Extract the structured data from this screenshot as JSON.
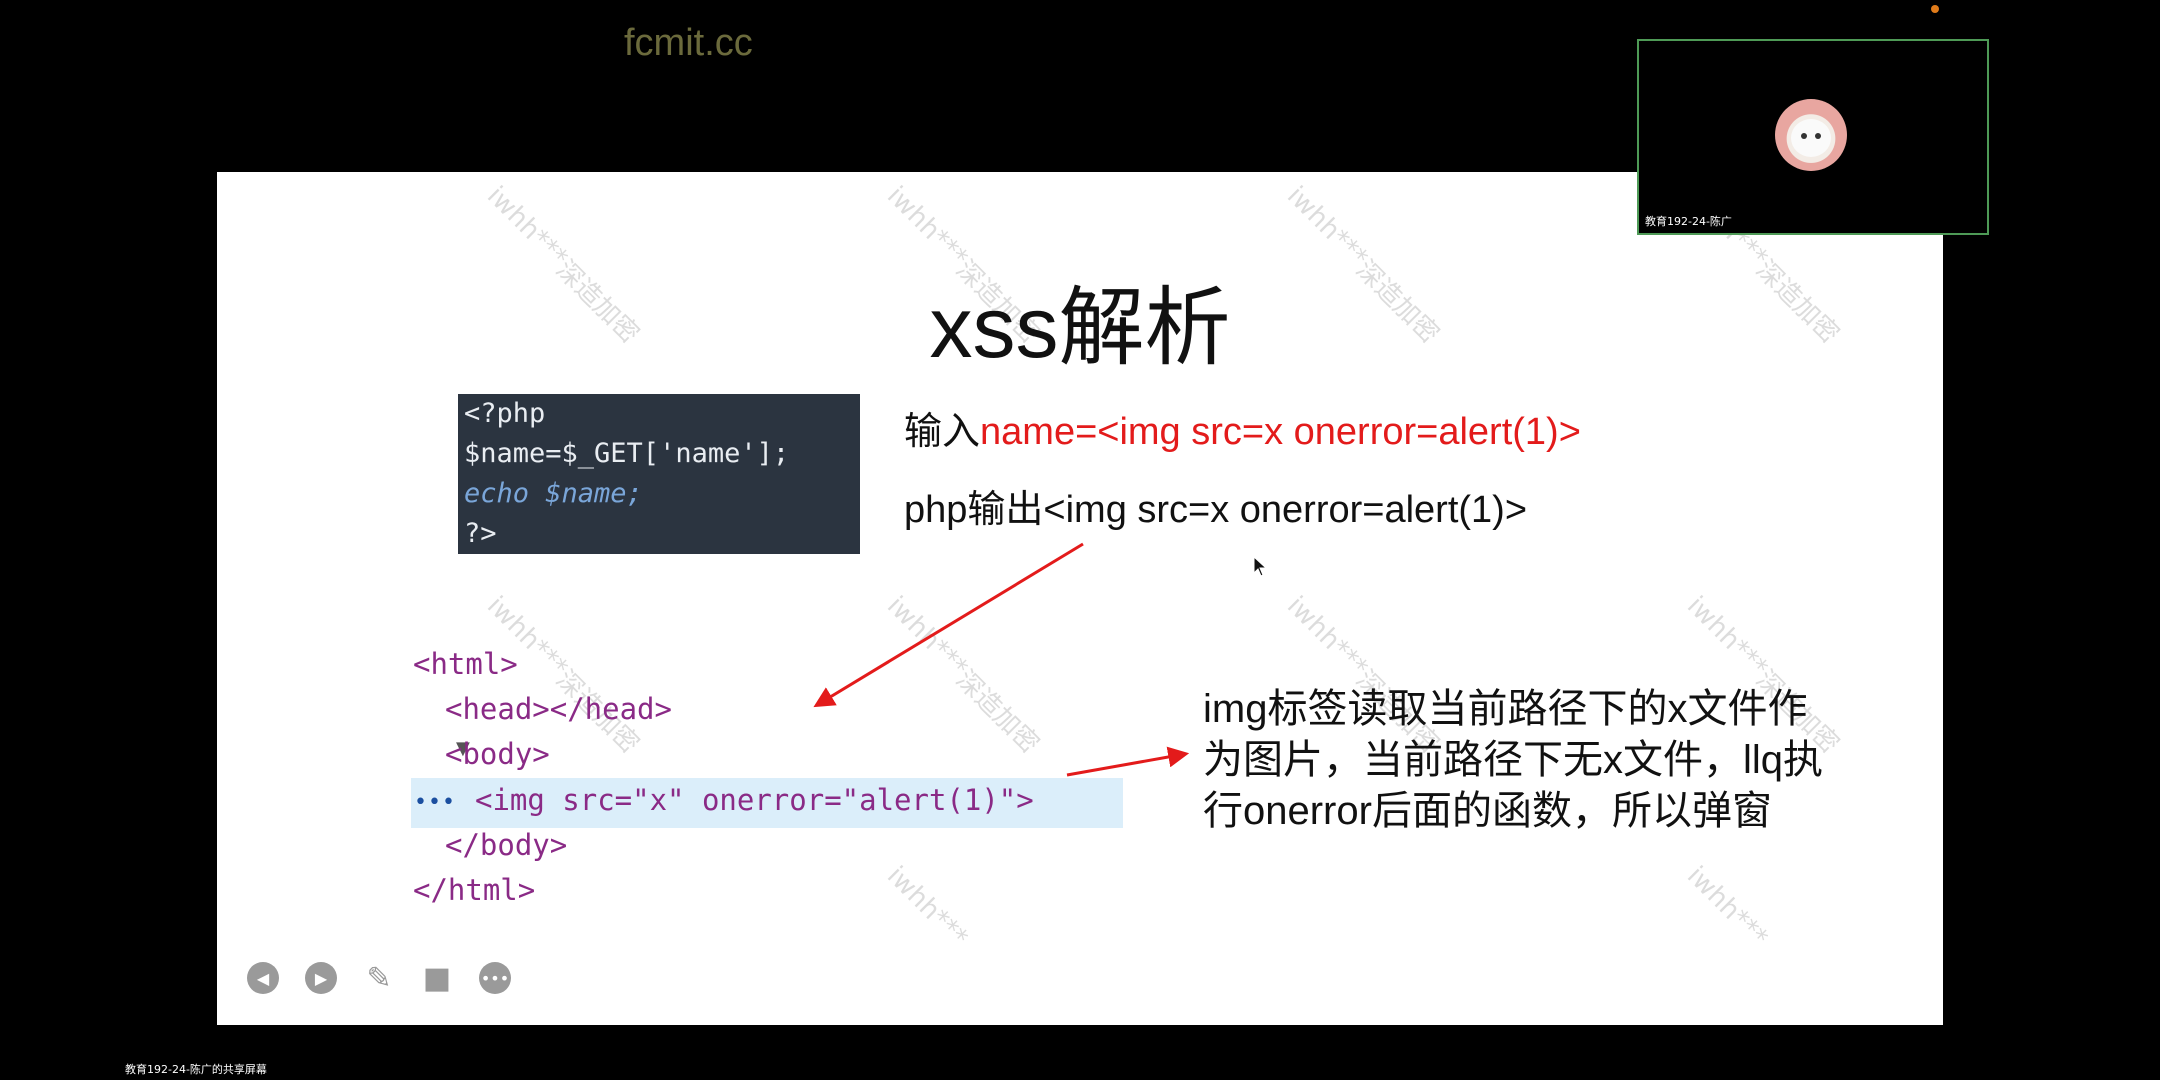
{
  "window": {
    "site_label": "fcmit.cc",
    "share_label": "教育192-24-陈广的共享屏幕"
  },
  "video_tile": {
    "participant_name": "教育192-24-陈广"
  },
  "slide": {
    "title": "xss解析",
    "php_code": [
      "<?php",
      "$name=$_GET['name'];",
      "echo $name;",
      "?>"
    ],
    "input_prefix": "输入",
    "input_payload": "name=<img src=x onerror=alert(1)>",
    "php_output": "php输出<img src=x onerror=alert(1)>",
    "dom_lines": [
      "<html>",
      "<head></head>",
      "<body>",
      "<img src=\"x\" onerror=\"alert(1)\">",
      "</body>",
      "</html>"
    ],
    "explanation": "img标签读取当前路径下的x文件作为图片，当前路径下无x文件，llq执行onerror后面的函数，所以弹窗",
    "watermark_user": "iwhh***",
    "watermark_org": "深造加密"
  },
  "toolbar": {
    "icons": [
      "prev-icon",
      "next-icon",
      "pen-icon",
      "camera-icon",
      "more-icon"
    ]
  },
  "colors": {
    "highlight_red": "#e31b1b",
    "video_border": "#4e9a56"
  }
}
